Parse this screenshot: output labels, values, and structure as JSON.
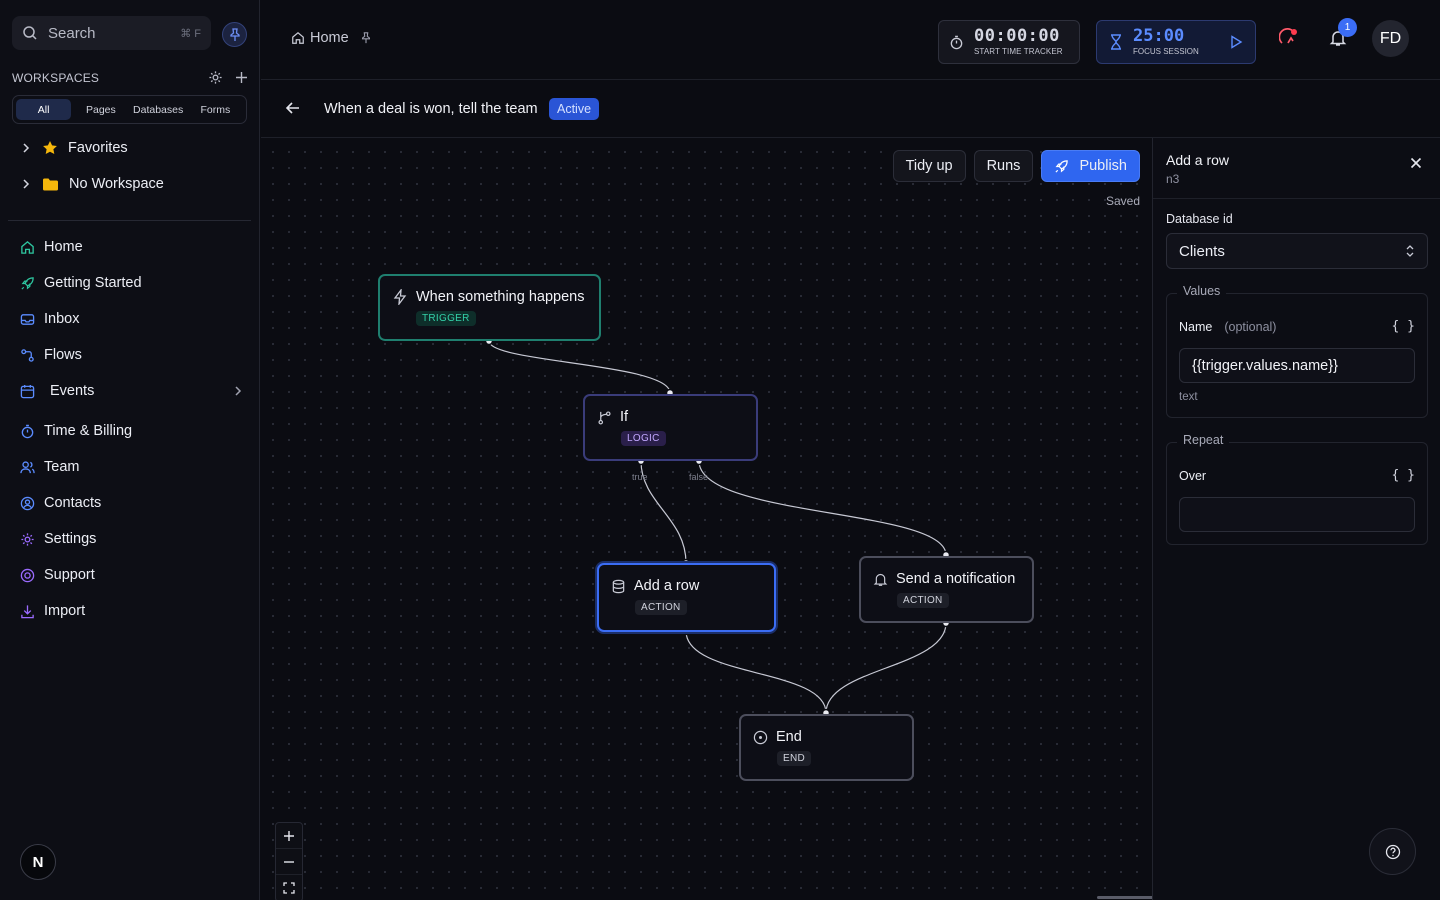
{
  "sidebar": {
    "search_placeholder": "Search",
    "search_shortcut": "⌘ F",
    "workspaces_title": "WORKSPACES",
    "filters": [
      "All",
      "Pages",
      "Databases",
      "Forms"
    ],
    "tree": [
      {
        "label": "Favorites",
        "icon": "star-icon"
      },
      {
        "label": "No Workspace",
        "icon": "folder-icon"
      }
    ],
    "nav": [
      {
        "label": "Home",
        "icon": "home-icon"
      },
      {
        "label": "Getting Started",
        "icon": "rocket-icon"
      },
      {
        "label": "Inbox",
        "icon": "inbox-icon"
      },
      {
        "label": "Flows",
        "icon": "flow-icon"
      },
      {
        "label": "Events",
        "icon": "calendar-icon"
      },
      {
        "label": "Time & Billing",
        "icon": "stopwatch-icon"
      },
      {
        "label": "Team",
        "icon": "users-icon"
      },
      {
        "label": "Contacts",
        "icon": "contact-icon"
      },
      {
        "label": "Settings",
        "icon": "gear-icon"
      },
      {
        "label": "Support",
        "icon": "lifebuoy-icon"
      },
      {
        "label": "Import",
        "icon": "import-icon"
      }
    ],
    "workspace_avatar": "N"
  },
  "topbar": {
    "breadcrumb": "Home",
    "tracker_time": "00:00:00",
    "tracker_label": "START TIME TRACKER",
    "focus_time": "25:00",
    "focus_label": "FOCUS SESSION",
    "notification_count": "1",
    "user_initials": "FD"
  },
  "flow": {
    "title": "When a deal is won, tell the team",
    "status": "Active"
  },
  "canvas": {
    "tidy_label": "Tidy up",
    "runs_label": "Runs",
    "publish_label": "Publish",
    "saved_label": "Saved",
    "nodes": {
      "trigger": {
        "title": "When something happens",
        "tag": "TRIGGER"
      },
      "if": {
        "title": "If",
        "tag": "LOGIC",
        "true_label": "true",
        "false_label": "false"
      },
      "add_row": {
        "title": "Add a row",
        "tag": "ACTION"
      },
      "notify": {
        "title": "Send a notification",
        "tag": "ACTION"
      },
      "end": {
        "title": "End",
        "tag": "END"
      }
    }
  },
  "panel": {
    "title": "Add a row",
    "node_id": "n3",
    "database_label": "Database id",
    "database_value": "Clients",
    "values_legend": "Values",
    "name_label": "Name",
    "name_optional": "(optional)",
    "braces": "{ }",
    "name_value": "{{trigger.values.name}}",
    "name_hint": "text",
    "repeat_legend": "Repeat",
    "over_label": "Over",
    "over_value": ""
  },
  "colors": {
    "accent": "#2f66f0",
    "trigger": "#1f7f6f",
    "logic": "#3a3c7a",
    "selected": "#3b6df5"
  }
}
